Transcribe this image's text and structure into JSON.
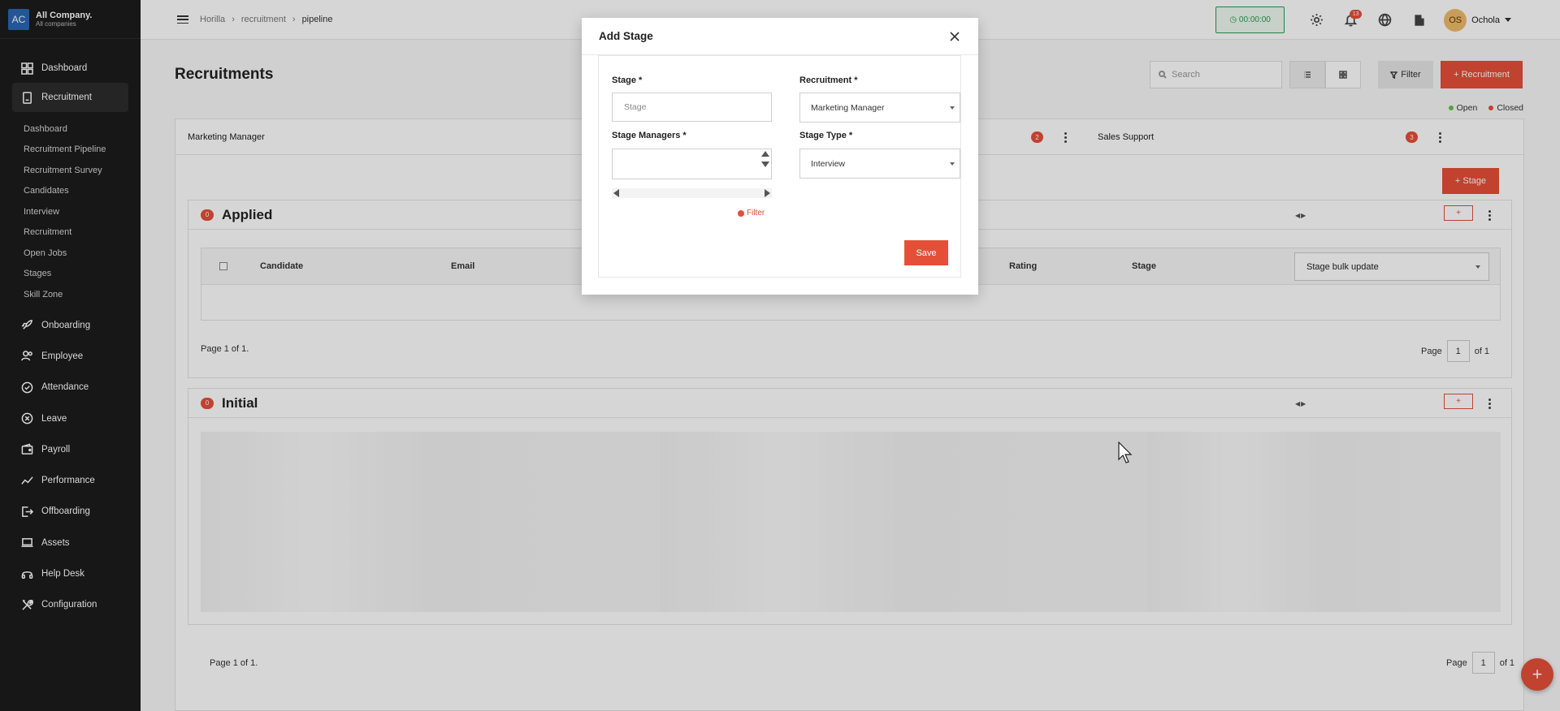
{
  "brand": {
    "logo": "AC",
    "name": "All Company.",
    "sub": "All companies"
  },
  "sidebar": {
    "top_items": [
      {
        "label": "Dashboard",
        "icon": "dashboard-icon"
      },
      {
        "label": "Recruitment",
        "icon": "recruitment-icon"
      }
    ],
    "sub_items": [
      "Dashboard",
      "Recruitment Pipeline",
      "Recruitment Survey",
      "Candidates",
      "Interview",
      "Recruitment",
      "Open Jobs",
      "Stages",
      "Skill Zone"
    ],
    "lower_items": [
      {
        "label": "Onboarding",
        "icon": "rocket-icon"
      },
      {
        "label": "Employee",
        "icon": "people-icon"
      },
      {
        "label": "Attendance",
        "icon": "check-circle-icon"
      },
      {
        "label": "Leave",
        "icon": "x-circle-icon"
      },
      {
        "label": "Payroll",
        "icon": "wallet-icon"
      },
      {
        "label": "Performance",
        "icon": "trend-icon"
      },
      {
        "label": "Offboarding",
        "icon": "exit-icon"
      },
      {
        "label": "Assets",
        "icon": "laptop-icon"
      },
      {
        "label": "Help Desk",
        "icon": "headset-icon"
      },
      {
        "label": "Configuration",
        "icon": "tools-icon"
      }
    ]
  },
  "topbar": {
    "breadcrumb": [
      "Horilla",
      "recruitment",
      "pipeline"
    ],
    "timer": "00:00:00",
    "notifications": "13",
    "user_initials": "OS",
    "user_name": "Ochola"
  },
  "main": {
    "title": "Recruitments",
    "search_placeholder": "Search",
    "filter_label": "Filter",
    "add_recruitment_label": "+ Recruitment",
    "legend": {
      "open": "Open",
      "closed": "Closed",
      "open_color": "#6abf4b",
      "closed_color": "#e54f38"
    },
    "tabs": [
      {
        "name": "Marketing Manager",
        "count": ""
      },
      {
        "name": "",
        "count": "2"
      },
      {
        "name": "Sales Support",
        "count": "3"
      }
    ],
    "add_stage_label": "+ Stage",
    "stages": [
      {
        "title": "Applied",
        "count": "0",
        "plus": "+"
      },
      {
        "title": "Initial",
        "count": "0",
        "plus": "+"
      }
    ],
    "table_headers": {
      "candidate": "Candidate",
      "email": "Email",
      "rating": "Rating",
      "stage": "Stage"
    },
    "bulk_update": "Stage bulk update",
    "stage_pager": {
      "text": "Page 1 of 1.",
      "page_label": "Page",
      "page": "1",
      "of": "of 1"
    },
    "bottom_pager": {
      "text": "Page 1 of 1.",
      "page_label": "Page",
      "page": "1",
      "of": "of 1"
    }
  },
  "modal": {
    "title": "Add Stage",
    "stage_label": "Stage *",
    "stage_placeholder": "Stage",
    "recruitment_label": "Recruitment *",
    "recruitment_value": "Marketing Manager",
    "managers_label": "Stage Managers *",
    "type_label": "Stage Type *",
    "type_value": "Interview",
    "filter_label": "Filter",
    "save_label": "Save"
  },
  "accent_color": "#e54f38"
}
